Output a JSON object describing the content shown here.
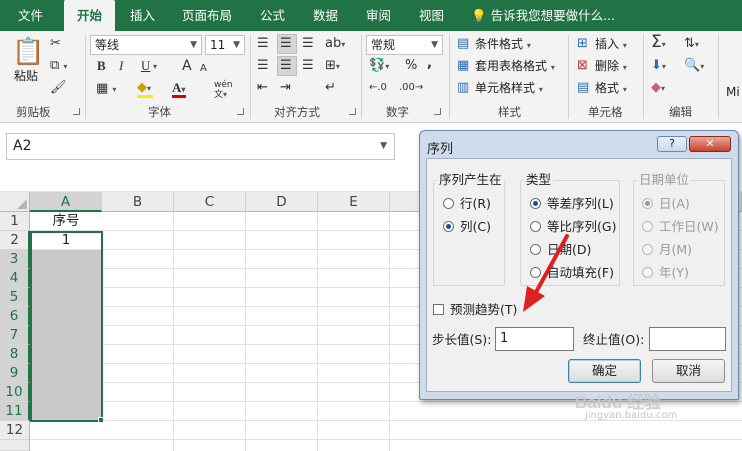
{
  "tabs": [
    {
      "label": "文件"
    },
    {
      "label": "开始"
    },
    {
      "label": "插入"
    },
    {
      "label": "页面布局"
    },
    {
      "label": "公式"
    },
    {
      "label": "数据"
    },
    {
      "label": "审阅"
    },
    {
      "label": "视图"
    }
  ],
  "tell_me": "告诉我您想要做什么...",
  "clipboard": {
    "paste": "粘贴",
    "label": "剪贴板"
  },
  "font": {
    "name": "等线",
    "size": "11",
    "bold": "B",
    "italic": "I",
    "underline": "U",
    "grow": "A",
    "shrink": "A",
    "phonetic": "wén",
    "label": "字体"
  },
  "alignment": {
    "label": "对齐方式"
  },
  "number": {
    "format": "常规",
    "percent": "%",
    "comma": ",",
    "label": "数字"
  },
  "styles": {
    "conditional": "条件格式",
    "table": "套用表格格式",
    "cell": "单元格样式",
    "label": "样式"
  },
  "cells": {
    "insert": "插入",
    "delete": "删除",
    "format": "格式",
    "label": "单元格"
  },
  "editing": {
    "label": "编辑"
  },
  "extra_label": "Mi",
  "name_box": "A2",
  "columns": [
    "A",
    "B",
    "C",
    "D",
    "E"
  ],
  "rows": [
    "1",
    "2",
    "3",
    "4",
    "5",
    "6",
    "7",
    "8",
    "9",
    "10",
    "11",
    "12"
  ],
  "cells_data": {
    "a1": "序号",
    "a2": "1"
  },
  "dialog": {
    "title": "序列",
    "help": "?",
    "close": "✕",
    "series_in": {
      "label": "序列产生在",
      "row": "行(R)",
      "col": "列(C)"
    },
    "type": {
      "label": "类型",
      "linear": "等差序列(L)",
      "growth": "等比序列(G)",
      "date": "日期(D)",
      "autofill": "自动填充(F)"
    },
    "date_unit": {
      "label": "日期单位",
      "day": "日(A)",
      "weekday": "工作日(W)",
      "month": "月(M)",
      "year": "年(Y)"
    },
    "trend": "预测趋势(T)",
    "step_label": "步长值(S):",
    "step_value": "1",
    "stop_label": "终止值(O):",
    "stop_value": "",
    "ok": "确定",
    "cancel": "取消"
  },
  "watermark": {
    "logo": "Baidu 经验",
    "url": "jingyan.baidu.com"
  },
  "colors": {
    "excel_green": "#217346",
    "arrow_red": "#e02020",
    "selection_gray": "#c9c9c9"
  }
}
